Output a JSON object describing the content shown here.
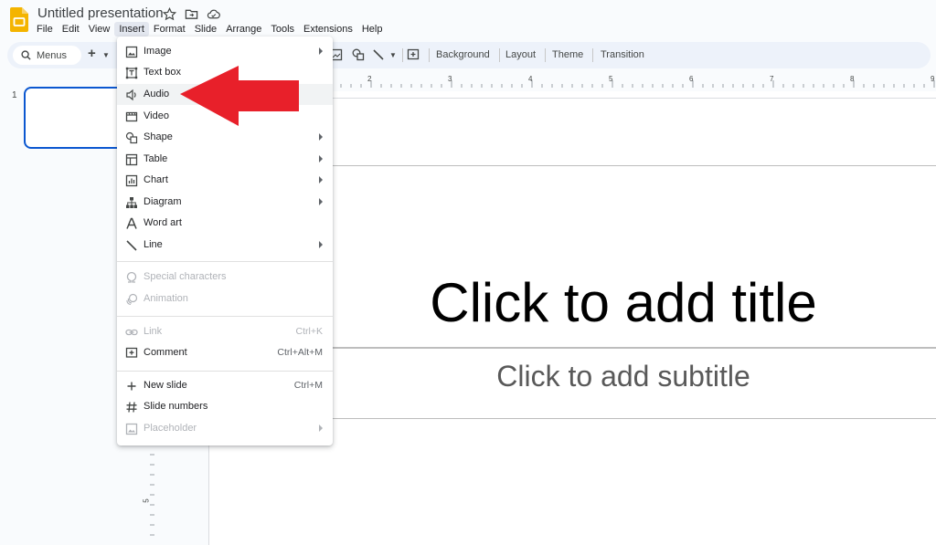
{
  "app": {
    "title": "Untitled presentation",
    "menus": [
      "File",
      "Edit",
      "View",
      "Insert",
      "Format",
      "Slide",
      "Arrange",
      "Tools",
      "Extensions",
      "Help"
    ],
    "active_menu_index": 3
  },
  "toolbar": {
    "search_label": "Menus",
    "background_label": "Background",
    "layout_label": "Layout",
    "theme_label": "Theme",
    "transition_label": "Transition"
  },
  "ruler": {
    "h_numbers": [
      "2",
      "3",
      "4",
      "5",
      "6",
      "7",
      "8",
      "9"
    ],
    "v_number": "5"
  },
  "filmstrip": {
    "slide_number": "1"
  },
  "slide": {
    "title_placeholder": "Click to add title",
    "subtitle_placeholder": "Click to add subtitle"
  },
  "insert_menu": {
    "items": [
      {
        "label": "Image",
        "icon": "image-icon",
        "submenu": true
      },
      {
        "label": "Text box",
        "icon": "text-box-icon",
        "submenu": false
      },
      {
        "label": "Audio",
        "icon": "audio-icon",
        "submenu": false,
        "highlighted": true
      },
      {
        "label": "Video",
        "icon": "video-icon",
        "submenu": false
      },
      {
        "label": "Shape",
        "icon": "shape-icon",
        "submenu": true
      },
      {
        "label": "Table",
        "icon": "table-icon",
        "submenu": true
      },
      {
        "label": "Chart",
        "icon": "chart-icon",
        "submenu": true
      },
      {
        "label": "Diagram",
        "icon": "diagram-icon",
        "submenu": true
      },
      {
        "label": "Word art",
        "icon": "word-art-icon",
        "submenu": false
      },
      {
        "label": "Line",
        "icon": "line-icon",
        "submenu": true
      },
      {
        "label": "Special characters",
        "icon": "omega-icon",
        "submenu": false,
        "disabled": true
      },
      {
        "label": "Animation",
        "icon": "animation-icon",
        "submenu": false,
        "disabled": true
      },
      {
        "label": "Link",
        "icon": "link-icon",
        "shortcut": "Ctrl+K",
        "disabled": true
      },
      {
        "label": "Comment",
        "icon": "comment-icon",
        "shortcut": "Ctrl+Alt+M"
      },
      {
        "label": "New slide",
        "icon": "plus-icon",
        "shortcut": "Ctrl+M"
      },
      {
        "label": "Slide numbers",
        "icon": "hash-icon"
      },
      {
        "label": "Placeholder",
        "icon": "placeholder-icon",
        "submenu": true,
        "disabled": true
      }
    ]
  },
  "annotation": {
    "arrow_color": "#e8202a"
  }
}
